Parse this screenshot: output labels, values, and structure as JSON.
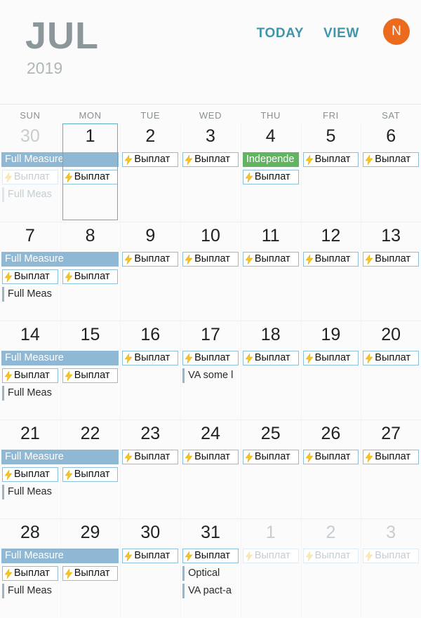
{
  "header": {
    "month": "JUL",
    "year": "2019",
    "today_label": "TODAY",
    "view_label": "VIEW",
    "avatar_initial": "N",
    "overflow_label": "more-options"
  },
  "weekdays": [
    "SUN",
    "MON",
    "TUE",
    "WED",
    "THU",
    "FRI",
    "SAT"
  ],
  "colors": {
    "accent_teal": "#4095ab",
    "banner_blue": "#8fb8d4",
    "chip_border": "#8cc0da",
    "holiday_green": "#62b463",
    "avatar_orange": "#ec6a1e",
    "month_gray": "#8c979c",
    "year_gray": "#aeb6ba",
    "bolt_yellow": "#f6c324",
    "bare_bar_gray": "#9fb4c2"
  },
  "selection": {
    "day": "1",
    "week": 0,
    "column": 1
  },
  "event_labels": {
    "full_measure": "Full Measure",
    "full_meas_short": "Full Meas",
    "vyplata": "Выплат",
    "independence": "Independe",
    "va_some": "VA some l",
    "optical": "Optical",
    "va_pact": "VA pact-a"
  },
  "weeks": [
    {
      "days": [
        {
          "num": "30",
          "muted": true
        },
        {
          "num": "1",
          "muted": false
        },
        {
          "num": "2",
          "muted": false
        },
        {
          "num": "3",
          "muted": false
        },
        {
          "num": "4",
          "muted": false
        },
        {
          "num": "5",
          "muted": false
        },
        {
          "num": "6",
          "muted": false
        }
      ],
      "events": [
        {
          "kind": "banner",
          "label": "Full Measure",
          "col": 0,
          "span": 2,
          "row": 0,
          "faded": false
        },
        {
          "kind": "chip",
          "label": "Выплат",
          "col": 2,
          "span": 1,
          "row": 0,
          "faded": false
        },
        {
          "kind": "chip",
          "label": "Выплат",
          "col": 3,
          "span": 1,
          "row": 0,
          "faded": false
        },
        {
          "kind": "chip-green",
          "label": "Independe",
          "col": 4,
          "span": 1,
          "row": 0,
          "faded": false
        },
        {
          "kind": "chip",
          "label": "Выплат",
          "col": 5,
          "span": 1,
          "row": 0,
          "faded": false
        },
        {
          "kind": "chip",
          "label": "Выплат",
          "col": 6,
          "span": 1,
          "row": 0,
          "faded": false
        },
        {
          "kind": "chip",
          "label": "Выплат",
          "col": 0,
          "span": 1,
          "row": 1,
          "faded": true
        },
        {
          "kind": "chip",
          "label": "Выплат",
          "col": 1,
          "span": 1,
          "row": 1,
          "faded": false
        },
        {
          "kind": "chip",
          "label": "Выплат",
          "col": 4,
          "span": 1,
          "row": 1,
          "faded": false
        },
        {
          "kind": "bare",
          "label": "Full Meas",
          "col": 0,
          "span": 1,
          "row": 2,
          "faded": true
        }
      ]
    },
    {
      "days": [
        {
          "num": "7",
          "muted": false
        },
        {
          "num": "8",
          "muted": false
        },
        {
          "num": "9",
          "muted": false
        },
        {
          "num": "10",
          "muted": false
        },
        {
          "num": "11",
          "muted": false
        },
        {
          "num": "12",
          "muted": false
        },
        {
          "num": "13",
          "muted": false
        }
      ],
      "events": [
        {
          "kind": "banner",
          "label": "Full Measure",
          "col": 0,
          "span": 2,
          "row": 0,
          "faded": false
        },
        {
          "kind": "chip",
          "label": "Выплат",
          "col": 2,
          "span": 1,
          "row": 0,
          "faded": false
        },
        {
          "kind": "chip",
          "label": "Выплат",
          "col": 3,
          "span": 1,
          "row": 0,
          "faded": false
        },
        {
          "kind": "chip",
          "label": "Выплат",
          "col": 4,
          "span": 1,
          "row": 0,
          "faded": false
        },
        {
          "kind": "chip",
          "label": "Выплат",
          "col": 5,
          "span": 1,
          "row": 0,
          "faded": false
        },
        {
          "kind": "chip",
          "label": "Выплат",
          "col": 6,
          "span": 1,
          "row": 0,
          "faded": false
        },
        {
          "kind": "chip",
          "label": "Выплат",
          "col": 0,
          "span": 1,
          "row": 1,
          "faded": false
        },
        {
          "kind": "chip",
          "label": "Выплат",
          "col": 1,
          "span": 1,
          "row": 1,
          "faded": false
        },
        {
          "kind": "bare",
          "label": "Full Meas",
          "col": 0,
          "span": 1,
          "row": 2,
          "faded": false
        }
      ]
    },
    {
      "days": [
        {
          "num": "14",
          "muted": false
        },
        {
          "num": "15",
          "muted": false
        },
        {
          "num": "16",
          "muted": false
        },
        {
          "num": "17",
          "muted": false
        },
        {
          "num": "18",
          "muted": false
        },
        {
          "num": "19",
          "muted": false
        },
        {
          "num": "20",
          "muted": false
        }
      ],
      "events": [
        {
          "kind": "banner",
          "label": "Full Measure",
          "col": 0,
          "span": 2,
          "row": 0,
          "faded": false
        },
        {
          "kind": "chip",
          "label": "Выплат",
          "col": 2,
          "span": 1,
          "row": 0,
          "faded": false
        },
        {
          "kind": "chip",
          "label": "Выплат",
          "col": 3,
          "span": 1,
          "row": 0,
          "faded": false
        },
        {
          "kind": "chip",
          "label": "Выплат",
          "col": 4,
          "span": 1,
          "row": 0,
          "faded": false
        },
        {
          "kind": "chip",
          "label": "Выплат",
          "col": 5,
          "span": 1,
          "row": 0,
          "faded": false
        },
        {
          "kind": "chip",
          "label": "Выплат",
          "col": 6,
          "span": 1,
          "row": 0,
          "faded": false
        },
        {
          "kind": "chip",
          "label": "Выплат",
          "col": 0,
          "span": 1,
          "row": 1,
          "faded": false
        },
        {
          "kind": "chip",
          "label": "Выплат",
          "col": 1,
          "span": 1,
          "row": 1,
          "faded": false
        },
        {
          "kind": "bare",
          "label": "VA some l",
          "col": 3,
          "span": 1,
          "row": 1,
          "faded": false
        },
        {
          "kind": "bare",
          "label": "Full Meas",
          "col": 0,
          "span": 1,
          "row": 2,
          "faded": false
        }
      ]
    },
    {
      "days": [
        {
          "num": "21",
          "muted": false
        },
        {
          "num": "22",
          "muted": false
        },
        {
          "num": "23",
          "muted": false
        },
        {
          "num": "24",
          "muted": false
        },
        {
          "num": "25",
          "muted": false
        },
        {
          "num": "26",
          "muted": false
        },
        {
          "num": "27",
          "muted": false
        }
      ],
      "events": [
        {
          "kind": "banner",
          "label": "Full Measure",
          "col": 0,
          "span": 2,
          "row": 0,
          "faded": false
        },
        {
          "kind": "chip",
          "label": "Выплат",
          "col": 2,
          "span": 1,
          "row": 0,
          "faded": false
        },
        {
          "kind": "chip",
          "label": "Выплат",
          "col": 3,
          "span": 1,
          "row": 0,
          "faded": false
        },
        {
          "kind": "chip",
          "label": "Выплат",
          "col": 4,
          "span": 1,
          "row": 0,
          "faded": false
        },
        {
          "kind": "chip",
          "label": "Выплат",
          "col": 5,
          "span": 1,
          "row": 0,
          "faded": false
        },
        {
          "kind": "chip",
          "label": "Выплат",
          "col": 6,
          "span": 1,
          "row": 0,
          "faded": false
        },
        {
          "kind": "chip",
          "label": "Выплат",
          "col": 0,
          "span": 1,
          "row": 1,
          "faded": false
        },
        {
          "kind": "chip",
          "label": "Выплат",
          "col": 1,
          "span": 1,
          "row": 1,
          "faded": false
        },
        {
          "kind": "bare",
          "label": "Full Meas",
          "col": 0,
          "span": 1,
          "row": 2,
          "faded": false
        }
      ]
    },
    {
      "days": [
        {
          "num": "28",
          "muted": false
        },
        {
          "num": "29",
          "muted": false
        },
        {
          "num": "30",
          "muted": false
        },
        {
          "num": "31",
          "muted": false
        },
        {
          "num": "1",
          "muted": true
        },
        {
          "num": "2",
          "muted": true
        },
        {
          "num": "3",
          "muted": true
        }
      ],
      "events": [
        {
          "kind": "banner",
          "label": "Full Measure",
          "col": 0,
          "span": 2,
          "row": 0,
          "faded": false
        },
        {
          "kind": "chip",
          "label": "Выплат",
          "col": 2,
          "span": 1,
          "row": 0,
          "faded": false
        },
        {
          "kind": "chip",
          "label": "Выплат",
          "col": 3,
          "span": 1,
          "row": 0,
          "faded": false
        },
        {
          "kind": "chip",
          "label": "Выплат",
          "col": 4,
          "span": 1,
          "row": 0,
          "faded": true
        },
        {
          "kind": "chip",
          "label": "Выплат",
          "col": 5,
          "span": 1,
          "row": 0,
          "faded": true
        },
        {
          "kind": "chip",
          "label": "Выплат",
          "col": 6,
          "span": 1,
          "row": 0,
          "faded": true
        },
        {
          "kind": "chip",
          "label": "Выплат",
          "col": 0,
          "span": 1,
          "row": 1,
          "faded": false
        },
        {
          "kind": "chip",
          "label": "Выплат",
          "col": 1,
          "span": 1,
          "row": 1,
          "faded": false
        },
        {
          "kind": "bare",
          "label": "Optical",
          "col": 3,
          "span": 1,
          "row": 1,
          "faded": false
        },
        {
          "kind": "bare",
          "label": "Full Meas",
          "col": 0,
          "span": 1,
          "row": 2,
          "faded": false
        },
        {
          "kind": "bare",
          "label": "VA pact-a",
          "col": 3,
          "span": 1,
          "row": 2,
          "faded": false
        }
      ]
    }
  ]
}
